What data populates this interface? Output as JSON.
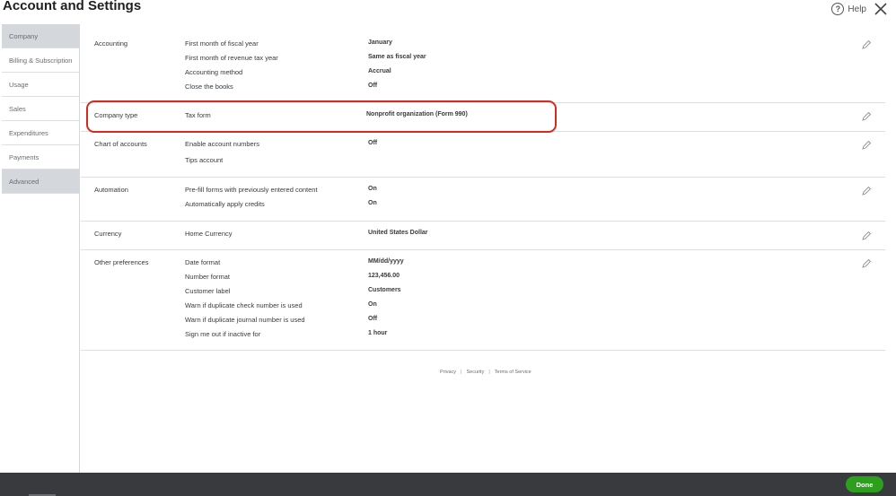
{
  "header": {
    "title": "Account and Settings",
    "help_label": "Help"
  },
  "sidebar": {
    "items": [
      {
        "label": "Company",
        "active": true
      },
      {
        "label": "Billing & Subscription",
        "active": false
      },
      {
        "label": "Usage",
        "active": false
      },
      {
        "label": "Sales",
        "active": false
      },
      {
        "label": "Expenditures",
        "active": false
      },
      {
        "label": "Payments",
        "active": false
      },
      {
        "label": "Advanced",
        "active": true
      }
    ]
  },
  "sections": {
    "accounting": {
      "title": "Accounting",
      "rows": [
        {
          "label": "First month of fiscal year",
          "value": "January"
        },
        {
          "label": "First month of revenue tax year",
          "value": "Same as fiscal year"
        },
        {
          "label": "Accounting method",
          "value": "Accrual"
        },
        {
          "label": "Close the books",
          "value": "Off"
        }
      ]
    },
    "company_type": {
      "title": "Company type",
      "rows": [
        {
          "label": "Tax form",
          "value": "Nonprofit organization (Form 990)"
        }
      ]
    },
    "chart_of_accounts": {
      "title": "Chart of accounts",
      "rows": [
        {
          "label": "Enable account numbers",
          "value": "Off"
        },
        {
          "label": "Tips account",
          "value": ""
        }
      ]
    },
    "automation": {
      "title": "Automation",
      "rows": [
        {
          "label": "Pre-fill forms with previously entered content",
          "value": "On"
        },
        {
          "label": "Automatically apply credits",
          "value": "On"
        }
      ]
    },
    "currency": {
      "title": "Currency",
      "rows": [
        {
          "label": "Home Currency",
          "value": "United States Dollar"
        }
      ]
    },
    "other_preferences": {
      "title": "Other preferences",
      "rows": [
        {
          "label": "Date format",
          "value": "MM/dd/yyyy"
        },
        {
          "label": "Number format",
          "value": "123,456.00"
        },
        {
          "label": "Customer label",
          "value": "Customers"
        },
        {
          "label": "Warn if duplicate check number is used",
          "value": "On"
        },
        {
          "label": "Warn if duplicate journal number is used",
          "value": "Off"
        },
        {
          "label": "Sign me out if inactive for",
          "value": "1 hour"
        }
      ]
    }
  },
  "footer": {
    "privacy": "Privacy",
    "separator": "|",
    "security": "Security",
    "terms": "Terms of Service"
  },
  "bottom": {
    "done_label": "Done"
  },
  "colors": {
    "highlight": "#d52b1e",
    "done_button": "#2ca01c",
    "bottom_bar": "#393a3d",
    "active_tab": "#d4d7dc"
  }
}
